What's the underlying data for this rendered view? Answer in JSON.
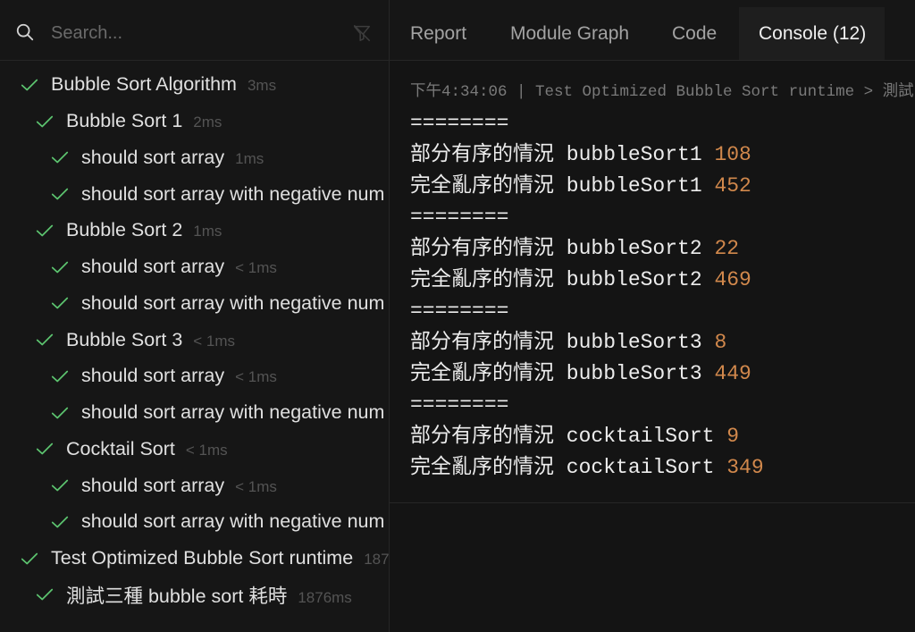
{
  "sidebar": {
    "search": {
      "placeholder": "Search..."
    },
    "search_icon": "search-icon",
    "filter_icon": "filter-off-icon",
    "status_icon": "check-icon",
    "tree": [
      {
        "name": "Bubble Sort Algorithm",
        "duration": "3ms",
        "children": [
          {
            "name": "Bubble Sort 1",
            "duration": "2ms",
            "children": [
              {
                "name": "should sort array",
                "duration": "1ms"
              },
              {
                "name": "should sort array with negative num"
              }
            ]
          },
          {
            "name": "Bubble Sort 2",
            "duration": "1ms",
            "children": [
              {
                "name": "should sort array",
                "duration": "< 1ms"
              },
              {
                "name": "should sort array with negative num"
              }
            ]
          },
          {
            "name": "Bubble Sort 3",
            "duration": "< 1ms",
            "children": [
              {
                "name": "should sort array",
                "duration": "< 1ms"
              },
              {
                "name": "should sort array with negative num"
              }
            ]
          },
          {
            "name": "Cocktail Sort",
            "duration": "< 1ms",
            "children": [
              {
                "name": "should sort array",
                "duration": "< 1ms"
              },
              {
                "name": "should sort array with negative num"
              }
            ]
          }
        ]
      },
      {
        "name": "Test Optimized Bubble Sort runtime",
        "duration": "187",
        "children": [
          {
            "name": "測試三種 bubble sort 耗時",
            "duration": "1876ms"
          }
        ]
      }
    ]
  },
  "tabs": [
    {
      "label": "Report",
      "active": false
    },
    {
      "label": "Module Graph",
      "active": false
    },
    {
      "label": "Code",
      "active": false
    },
    {
      "label": "Console (12)",
      "active": true
    }
  ],
  "console": {
    "header": "下午4:34:06 | Test Optimized Bubble Sort runtime > 測試",
    "lines": [
      {
        "text": "========"
      },
      {
        "text": "部分有序的情況 bubbleSort1",
        "value": 108
      },
      {
        "text": "完全亂序的情況 bubbleSort1",
        "value": 452
      },
      {
        "text": "========"
      },
      {
        "text": "部分有序的情況 bubbleSort2",
        "value": 22
      },
      {
        "text": "完全亂序的情況 bubbleSort2",
        "value": 469
      },
      {
        "text": "========"
      },
      {
        "text": "部分有序的情況 bubbleSort3",
        "value": 8
      },
      {
        "text": "完全亂序的情況 bubbleSort3",
        "value": 449
      },
      {
        "text": "========"
      },
      {
        "text": "部分有序的情況 cocktailSort",
        "value": 9
      },
      {
        "text": "完全亂序的情況 cocktailSort",
        "value": 349
      }
    ]
  },
  "colors": {
    "pass": "#5cc46f",
    "number": "#d1884c",
    "active_tab_bg": "#1e1e1e"
  }
}
